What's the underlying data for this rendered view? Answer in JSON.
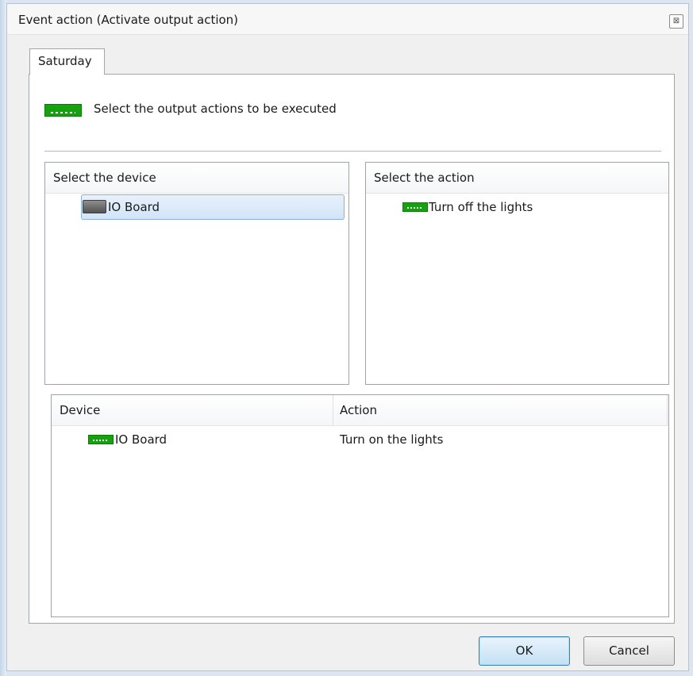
{
  "window": {
    "title": "Event action (Activate output action)",
    "close_glyph": "⊠"
  },
  "tabs": [
    {
      "label": "Saturday",
      "active": true
    }
  ],
  "header": {
    "icon": "output-action-icon",
    "text": "Select the output actions to be executed"
  },
  "device_panel": {
    "header": "Select the device",
    "items": [
      {
        "label": "IO Board",
        "icon": "io-board-icon",
        "selected": true
      }
    ]
  },
  "action_panel": {
    "header": "Select the action",
    "items": [
      {
        "label": "Turn off the lights",
        "icon": "output-action-icon"
      }
    ]
  },
  "assignments": {
    "columns": [
      "Device",
      "Action"
    ],
    "rows": [
      {
        "device": "IO Board",
        "action": "Turn on the lights",
        "icon": "output-action-icon"
      }
    ]
  },
  "buttons": {
    "ok": "OK",
    "cancel": "Cancel"
  },
  "colors": {
    "accent_green": "#16a10f",
    "selection": "#d2e4f8",
    "default_button_border": "#3c7fb1"
  }
}
